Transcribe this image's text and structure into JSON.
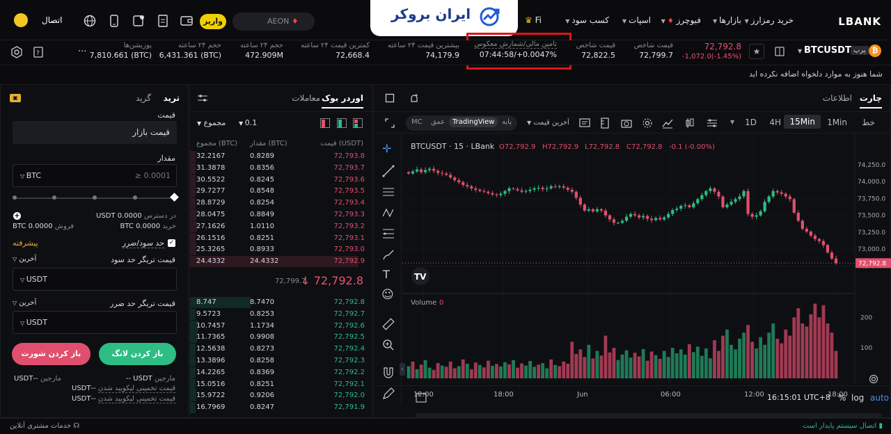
{
  "nav": {
    "brand": "LBANK",
    "buy_crypto": "خرید رمزارز",
    "markets": "بازارها",
    "futures": "فیوچرز",
    "spot": "اسپات",
    "earn": "کسب سود",
    "fi_partial": "Fi",
    "search_value": "AEON",
    "deposit": "واریز",
    "connect": "اتصال",
    "banner_text": "ایران بروکر"
  },
  "ticker": {
    "pair": "BTCUSDT",
    "pair_tag": "پرپ",
    "last_price": "72,792.8",
    "change": "-1,072.0(-1.45%)",
    "index_label": "قیمت شاخص",
    "index_value": "72,799.7",
    "mark_label": "قیمت شاخص",
    "mark_value": "72,822.5",
    "funding_label": "تامین مالی/شمارش معکوس",
    "funding_value": "07:44:58/+0.0047%",
    "high_label": "بیشترین قیمت ۲۴ ساعته",
    "high_value": "74,179.9",
    "low_label": "کمترین قیمت ۲۴ ساعته",
    "low_value": "72,668.4",
    "vol_label": "حجم ۲۴ ساعته",
    "vol_value": "472.909M",
    "vol_btc_label": "حجم ۲۴ ساعته",
    "vol_btc_value": "6,431.361 (BTC)",
    "oi_label": "پوزیشن‌ها",
    "oi_value": "7,810.661 (BTC)",
    "more": "···"
  },
  "notice": "شما هنوز به موارد دلخواه اضافه نکرده اید",
  "chart_panel": {
    "tab_chart": "چارت",
    "tab_info": "اطلاعات",
    "tf_line": "خط",
    "tf_1m": "1Min",
    "tf_15m": "15Min",
    "tf_4h": "4H",
    "tf_1d": "1D",
    "last_price_sel": "آخرین قیمت",
    "mode_basic": "پایه",
    "mode_tv": "TradingView",
    "mode_depth": "عمق",
    "mode_mc": "MC",
    "legend_title": "BTCUSDT · 15 · LBank",
    "legend_o": "O72,792.9",
    "legend_h": "H72,792.9",
    "legend_l": "L72,792.8",
    "legend_c": "C72,792.8",
    "legend_chg": "-0.1 (-0.00%)",
    "volume_label": "Volume",
    "volume_val": "0",
    "price_tag": "72,792.8",
    "clock": "16:15:01 UTC+8",
    "pct": "%",
    "log": "log",
    "auto": "auto"
  },
  "orderbook": {
    "tab_book": "اوردر بوک",
    "tab_trades": "معاملات",
    "precision": "0.1",
    "sum_sel": "مجموع",
    "col_price": "قیمت (USDT)",
    "col_qty": "مقدار (BTC)",
    "col_sum": "مجموع (BTC)",
    "asks": [
      {
        "price": "72,793.8",
        "qty": "0.8289",
        "sum": "32.2167"
      },
      {
        "price": "72,793.7",
        "qty": "0.8356",
        "sum": "31.3878"
      },
      {
        "price": "72,793.6",
        "qty": "0.8245",
        "sum": "30.5522"
      },
      {
        "price": "72,793.5",
        "qty": "0.8548",
        "sum": "29.7277"
      },
      {
        "price": "72,793.4",
        "qty": "0.8254",
        "sum": "28.8729"
      },
      {
        "price": "72,793.3",
        "qty": "0.8849",
        "sum": "28.0475"
      },
      {
        "price": "72,793.2",
        "qty": "1.0110",
        "sum": "27.1626"
      },
      {
        "price": "72,793.1",
        "qty": "0.8251",
        "sum": "26.1516"
      },
      {
        "price": "72,793.0",
        "qty": "0.8933",
        "sum": "25.3265"
      },
      {
        "price": "72,792.9",
        "qty": "24.4332",
        "sum": "24.4332"
      }
    ],
    "mid_price": "72,792.8",
    "mid_index": "72,799.7",
    "bids": [
      {
        "price": "72,792.8",
        "qty": "8.7470",
        "sum": "8.747"
      },
      {
        "price": "72,792.7",
        "qty": "0.8253",
        "sum": "9.5723"
      },
      {
        "price": "72,792.6",
        "qty": "1.1734",
        "sum": "10.7457"
      },
      {
        "price": "72,792.5",
        "qty": "0.9908",
        "sum": "11.7365"
      },
      {
        "price": "72,792.4",
        "qty": "0.8273",
        "sum": "12.5638"
      },
      {
        "price": "72,792.3",
        "qty": "0.8258",
        "sum": "13.3896"
      },
      {
        "price": "72,792.2",
        "qty": "0.8369",
        "sum": "14.2265"
      },
      {
        "price": "72,792.1",
        "qty": "0.8251",
        "sum": "15.0516"
      },
      {
        "price": "72,792.0",
        "qty": "0.9206",
        "sum": "15.9722"
      },
      {
        "price": "72,791.9",
        "qty": "0.8247",
        "sum": "16.7969"
      }
    ]
  },
  "trade": {
    "tab_trade": "ترید",
    "tab_grid": "گرید",
    "price_label": "قیمت",
    "price_value": "قیمت بازار",
    "qty_label": "مقدار",
    "qty_placeholder": "≥ 0.0001",
    "qty_unit": "BTC",
    "available_label": "در دسترس",
    "available_value": "0.0000 USDT",
    "buy_label": "خرید",
    "buy_value": "0.0000 BTC",
    "sell_label": "فروش",
    "sell_value": "0.0000 BTC",
    "tpsl_label": "حد سود/ضرر",
    "advanced": "پیشرفته",
    "tp_label": "قیمت تریگر حد سود",
    "tp_sel": "آخرین",
    "tp_unit": "USDT",
    "sl_label": "قیمت تریگر حد ضرر",
    "sl_sel": "آخرین",
    "sl_unit": "USDT",
    "long_btn": "باز کردن لانگ",
    "short_btn": "باز کردن شورت",
    "margin_label": "مارجین",
    "margin_long": "USDT --",
    "margin_short": "--USDT",
    "liq_label": "قیمت تخمینی لیکویید شدن",
    "liq_long1": "--USDT",
    "liq_long2": "--USDT"
  },
  "footer": {
    "status": "اتصال سیستم پایدار است",
    "support": "خدمات مشتری آنلاین"
  },
  "chart_data": {
    "type": "candlestick",
    "title": "BTCUSDT · 15 · LBank",
    "y_ticks": [
      "74,250.0",
      "74,000.0",
      "73,750.0",
      "73,500.0",
      "73,250.0",
      "73,000.0",
      "72,750.0"
    ],
    "ylim": [
      72600,
      74300
    ],
    "x_ticks": [
      "12:00",
      "18:00",
      "Jun",
      "06:00",
      "12:00",
      "18:00"
    ],
    "volume_ticks": [
      "200",
      "100"
    ],
    "closes": [
      74120,
      74150,
      74180,
      74140,
      74170,
      74190,
      74160,
      74130,
      74120,
      74100,
      74060,
      74020,
      73990,
      73950,
      73930,
      73900,
      73880,
      73860,
      73850,
      73830,
      73810,
      73800,
      73820,
      73860,
      73900,
      73890,
      73870,
      73850,
      73860,
      73880,
      73900,
      73910,
      73890,
      73900,
      73930,
      73920,
      73930,
      73910,
      73880,
      73850,
      73760,
      73660,
      73570,
      73590,
      73560,
      73590,
      73570,
      73500,
      73440,
      73390,
      73390,
      73420,
      73480,
      73520,
      73500,
      73470,
      73490,
      73450,
      73430,
      73460,
      73440,
      73470,
      73520,
      73580,
      73600,
      73640,
      73650,
      73620,
      73680,
      73740,
      73800,
      73860,
      73900,
      73850,
      73780,
      73620,
      73660,
      73700,
      73740,
      73780,
      73860,
      73520,
      73480,
      73500,
      73560,
      73700,
      73780,
      73860,
      73840,
      73820,
      73780,
      73740,
      73540,
      73420,
      73300,
      73260,
      73200,
      73150,
      73120,
      73060,
      72950,
      72860,
      72792.8
    ],
    "volumes": [
      40,
      55,
      30,
      45,
      60,
      35,
      28,
      50,
      42,
      38,
      55,
      33,
      40,
      62,
      48,
      30,
      52,
      44,
      36,
      58,
      41,
      47,
      39,
      53,
      46,
      60,
      35,
      49,
      42,
      57,
      38,
      45,
      50,
      33,
      62,
      44,
      40,
      55,
      48,
      120,
      80,
      95,
      70,
      110,
      65,
      90,
      75,
      140,
      85,
      100,
      60,
      78,
      92,
      68,
      84,
      72,
      96,
      58,
      88,
      76,
      64,
      90,
      70,
      100,
      82,
      95,
      78,
      112,
      86,
      104,
      74,
      98,
      66,
      125,
      90,
      140,
      160,
      110,
      95,
      130,
      150,
      175,
      120,
      98,
      135,
      110,
      150,
      180,
      130,
      115,
      160,
      140,
      200,
      230,
      180,
      170,
      210,
      245,
      200,
      240,
      180,
      150,
      90
    ],
    "volume_up": [
      true,
      false,
      true,
      false,
      true,
      true,
      false,
      false,
      true,
      false,
      false,
      false,
      true,
      false,
      true,
      false,
      false,
      true,
      false,
      false,
      true,
      false,
      true,
      true,
      false,
      true,
      false,
      false,
      true,
      true,
      true,
      false,
      true,
      true,
      false,
      true,
      false,
      false,
      false,
      false,
      false,
      false,
      false,
      true,
      false,
      true,
      false,
      false,
      false,
      false,
      true,
      true,
      true,
      true,
      false,
      false,
      true,
      false,
      false,
      true,
      false,
      true,
      true,
      true,
      true,
      true,
      true,
      false,
      true,
      true,
      true,
      true,
      true,
      false,
      false,
      false,
      true,
      true,
      true,
      true,
      true,
      false,
      false,
      true,
      true,
      true,
      true,
      true,
      false,
      false,
      false,
      false,
      false,
      false,
      false,
      false,
      false,
      false,
      false,
      false,
      false,
      false,
      false
    ]
  }
}
